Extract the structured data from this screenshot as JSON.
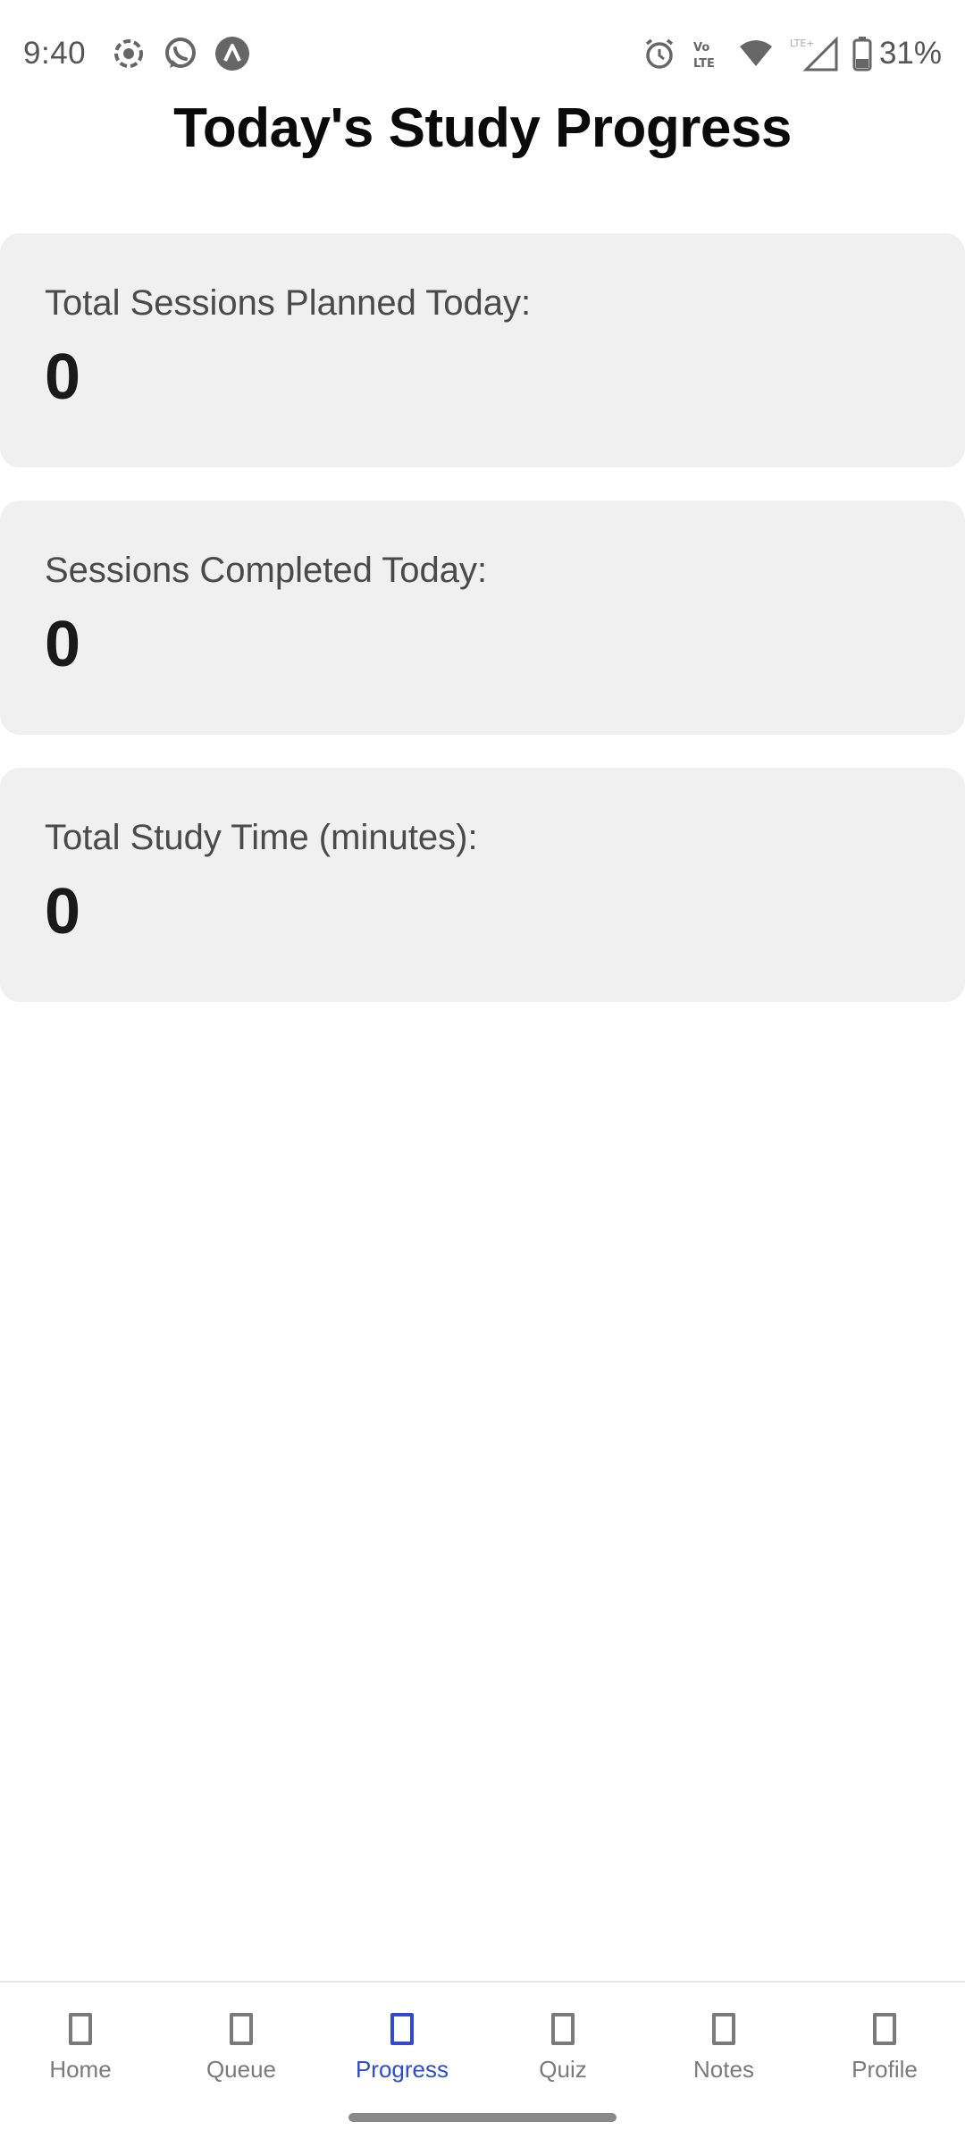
{
  "status_bar": {
    "time": "9:40",
    "battery": "31%",
    "left_icons": [
      "screen-record-icon",
      "whatsapp-icon",
      "app-notification-icon"
    ],
    "right_icons": [
      "alarm-icon",
      "volte-icon",
      "wifi-icon",
      "lte-signal-icon",
      "battery-icon"
    ]
  },
  "page": {
    "title": "Today's Study Progress"
  },
  "stats": [
    {
      "label": "Total Sessions Planned Today:",
      "value": "0"
    },
    {
      "label": "Sessions Completed Today:",
      "value": "0"
    },
    {
      "label": "Total Study Time (minutes):",
      "value": "0"
    }
  ],
  "nav": {
    "active": "Progress",
    "active_color": "#2f4bd0",
    "items": [
      {
        "label": "Home"
      },
      {
        "label": "Queue"
      },
      {
        "label": "Progress"
      },
      {
        "label": "Quiz"
      },
      {
        "label": "Notes"
      },
      {
        "label": "Profile"
      }
    ]
  }
}
